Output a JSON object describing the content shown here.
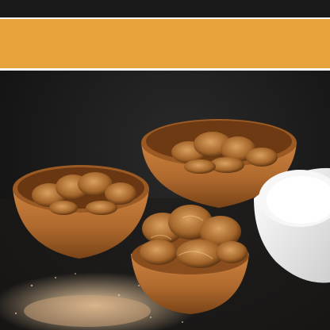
{
  "header": {
    "title": ""
  },
  "band": {
    "lines": [
      "",
      "",
      "",
      "",
      ""
    ]
  },
  "caption": {
    "lines": [
      "",
      ""
    ]
  },
  "colors": {
    "background": "#141414",
    "accent_band": "#e8a43c",
    "bowl_wood": "#c07a3a",
    "walnut": "#b0702e",
    "cream_bowl": "#f2f2f2"
  },
  "icons": [
    "header-divider",
    "orange-title-band"
  ]
}
